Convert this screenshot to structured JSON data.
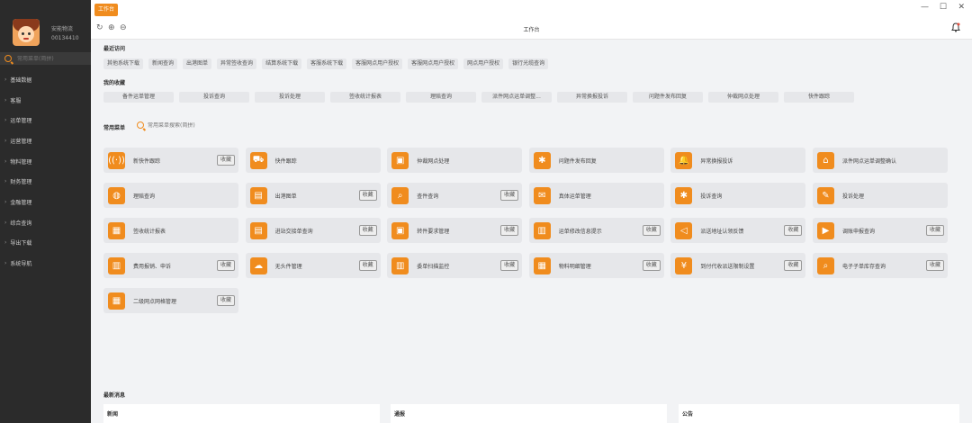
{
  "user": {
    "name": "安能物流",
    "id": "00134410"
  },
  "sidebar": {
    "search_placeholder": "常用菜单(简拼)",
    "items": [
      "基础数据",
      "客服",
      "运单管理",
      "运营管理",
      "物料管理",
      "财务管理",
      "金融管理",
      "综合查询",
      "导出下载",
      "系统导航"
    ]
  },
  "topbar": {
    "active_tab": "工作台",
    "minimize": "—",
    "maximize": "☐",
    "close": "✕"
  },
  "toolbar": {
    "title": "工作台",
    "refresh": "↻",
    "zoom_in": "⊕",
    "zoom_out": "⊖"
  },
  "recent": {
    "title": "最近访问",
    "items": [
      "其他系统下载",
      "新闻查询",
      "出港图单",
      "异常签收查询",
      "结算系统下载",
      "客服系统下载",
      "客服网点用户授权",
      "客服网点用户授权",
      "网点用户授权",
      "银行光缆查询"
    ]
  },
  "favorites": {
    "title": "我的收藏",
    "items": [
      "备件运单管理",
      "投诉查询",
      "投诉处理",
      "签收统计报表",
      "理赔查询",
      "派件网点运单调整...",
      "异常换报投诉",
      "问题件发布回复",
      "仲裁网点处理",
      "快件跟踪"
    ]
  },
  "common": {
    "title": "常用菜单",
    "search_placeholder": "常用菜单搜索(简拼)",
    "save_label": "收藏",
    "cards": [
      {
        "label": "新快件跟踪",
        "icon": "((·))",
        "saved": true
      },
      {
        "label": "快件跟踪",
        "icon": "⛟",
        "saved": false
      },
      {
        "label": "仲裁网点处理",
        "icon": "▣",
        "saved": false
      },
      {
        "label": "问题件发布回复",
        "icon": "✱",
        "saved": false
      },
      {
        "label": "异常换报投诉",
        "icon": "🔔",
        "saved": false
      },
      {
        "label": "派件网点运单调整确认",
        "icon": "⌂",
        "saved": false
      },
      {
        "label": "理赔查询",
        "icon": "◍",
        "saved": false
      },
      {
        "label": "出港图单",
        "icon": "▤",
        "saved": true
      },
      {
        "label": "查件查询",
        "icon": "⌕",
        "saved": true
      },
      {
        "label": "真体运单管理",
        "icon": "✉",
        "saved": false
      },
      {
        "label": "投诉查询",
        "icon": "✱",
        "saved": false
      },
      {
        "label": "投诉处理",
        "icon": "✎",
        "saved": false
      },
      {
        "label": "签收统计报表",
        "icon": "▦",
        "saved": false
      },
      {
        "label": "进站交接单查询",
        "icon": "▤",
        "saved": true
      },
      {
        "label": "转件要求管理",
        "icon": "▣",
        "saved": true
      },
      {
        "label": "运单修改信息提示",
        "icon": "▥",
        "saved": true
      },
      {
        "label": "派送地址认领反馈",
        "icon": "◁",
        "saved": true
      },
      {
        "label": "调账申报查询",
        "icon": "▶",
        "saved": true
      },
      {
        "label": "费用报销、申诉",
        "icon": "▥",
        "saved": true
      },
      {
        "label": "无头件管理",
        "icon": "☁",
        "saved": true
      },
      {
        "label": "委单扫描监控",
        "icon": "▥",
        "saved": true
      },
      {
        "label": "物料明细管理",
        "icon": "▦",
        "saved": true
      },
      {
        "label": "到付代收派送限制设置",
        "icon": "¥",
        "saved": true
      },
      {
        "label": "电子子单库存查询",
        "icon": "⌕",
        "saved": true
      },
      {
        "label": "二级网点网格管理",
        "icon": "▦",
        "saved": true
      }
    ]
  },
  "news": {
    "title": "最新消息",
    "panels": [
      "新闻",
      "通报",
      "公告"
    ]
  }
}
